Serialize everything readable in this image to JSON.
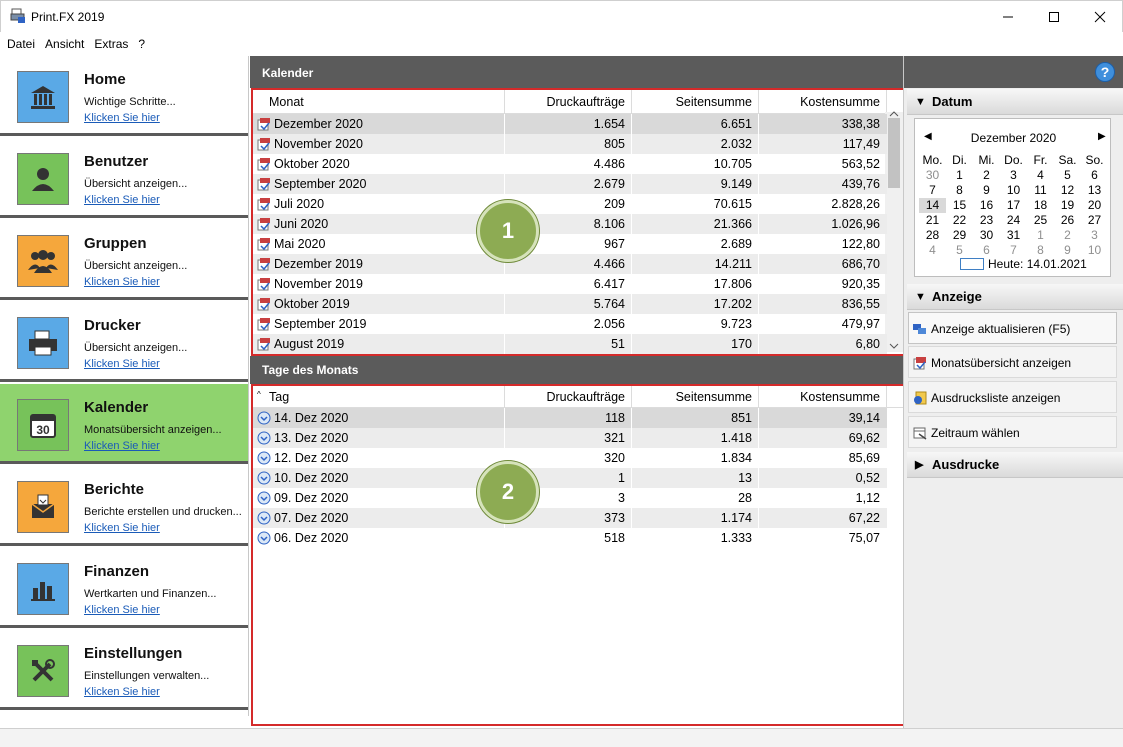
{
  "window": {
    "title": "Print.FX 2019"
  },
  "menu": [
    "Datei",
    "Ansicht",
    "Extras",
    "?"
  ],
  "nav": [
    {
      "title": "Home",
      "desc": "Wichtige Schritte...",
      "link": "Klicken Sie hier",
      "icon": "bank-icon",
      "color": "#5aa9e6"
    },
    {
      "title": "Benutzer",
      "desc": "Übersicht anzeigen...",
      "link": "Klicken Sie hier",
      "icon": "user-icon",
      "color": "#77c25a"
    },
    {
      "title": "Gruppen",
      "desc": "Übersicht anzeigen...",
      "link": "Klicken Sie hier",
      "icon": "group-icon",
      "color": "#f5a73c"
    },
    {
      "title": "Drucker",
      "desc": "Übersicht anzeigen...",
      "link": "Klicken Sie hier",
      "icon": "printer-icon",
      "color": "#5aa9e6"
    },
    {
      "title": "Kalender",
      "desc": "Monatsübersicht anzeigen...",
      "link": "Klicken Sie hier",
      "icon": "calendar-icon",
      "color": "#77c25a"
    },
    {
      "title": "Berichte",
      "desc": "Berichte erstellen und drucken...",
      "link": "Klicken Sie hier",
      "icon": "report-icon",
      "color": "#f5a73c"
    },
    {
      "title": "Finanzen",
      "desc": "Wertkarten und Finanzen...",
      "link": "Klicken Sie hier",
      "icon": "bar-chart-icon",
      "color": "#5aa9e6"
    },
    {
      "title": "Einstellungen",
      "desc": "Einstellungen verwalten...",
      "link": "Klicken Sie hier",
      "icon": "tools-icon",
      "color": "#77c25a"
    }
  ],
  "calendar_panel": {
    "title": "Kalender",
    "columns": [
      "Monat",
      "Druckaufträge",
      "Seitensumme",
      "Kostensumme"
    ],
    "rows": [
      [
        "Dezember 2020",
        "1.654",
        "6.651",
        "338,38"
      ],
      [
        "November 2020",
        "805",
        "2.032",
        "117,49"
      ],
      [
        "Oktober 2020",
        "4.486",
        "10.705",
        "563,52"
      ],
      [
        "September 2020",
        "2.679",
        "9.149",
        "439,76"
      ],
      [
        "Juli 2020",
        "209",
        "70.615",
        "2.828,26"
      ],
      [
        "Juni 2020",
        "8.106",
        "21.366",
        "1.026,96"
      ],
      [
        "Mai 2020",
        "967",
        "2.689",
        "122,80"
      ],
      [
        "Dezember 2019",
        "4.466",
        "14.211",
        "686,70"
      ],
      [
        "November 2019",
        "6.417",
        "17.806",
        "920,35"
      ],
      [
        "Oktober 2019",
        "5.764",
        "17.202",
        "836,55"
      ],
      [
        "September 2019",
        "2.056",
        "9.723",
        "479,97"
      ],
      [
        "August 2019",
        "51",
        "170",
        "6,80"
      ]
    ],
    "badge": "1"
  },
  "days_panel": {
    "title": "Tage des Monats",
    "columns": [
      "Tag",
      "Druckaufträge",
      "Seitensumme",
      "Kostensumme"
    ],
    "rows": [
      [
        "14. Dez 2020",
        "118",
        "851",
        "39,14"
      ],
      [
        "13. Dez 2020",
        "321",
        "1.418",
        "69,62"
      ],
      [
        "12. Dez 2020",
        "320",
        "1.834",
        "85,69"
      ],
      [
        "10. Dez 2020",
        "1",
        "13",
        "0,52"
      ],
      [
        "09. Dez 2020",
        "3",
        "28",
        "1,12"
      ],
      [
        "07. Dez 2020",
        "373",
        "1.174",
        "67,22"
      ],
      [
        "06. Dez 2020",
        "518",
        "1.333",
        "75,07"
      ]
    ],
    "badge": "2"
  },
  "right": {
    "help": "?",
    "datum": {
      "header": "Datum",
      "month": "Dezember 2020",
      "weekdays": [
        "Mo.",
        "Di.",
        "Mi.",
        "Do.",
        "Fr.",
        "Sa.",
        "So."
      ],
      "weeks": [
        [
          "30",
          "1",
          "2",
          "3",
          "4",
          "5",
          "6"
        ],
        [
          "7",
          "8",
          "9",
          "10",
          "11",
          "12",
          "13"
        ],
        [
          "14",
          "15",
          "16",
          "17",
          "18",
          "19",
          "20"
        ],
        [
          "21",
          "22",
          "23",
          "24",
          "25",
          "26",
          "27"
        ],
        [
          "28",
          "29",
          "30",
          "31",
          "1",
          "2",
          "3"
        ],
        [
          "4",
          "5",
          "6",
          "7",
          "8",
          "9",
          "10"
        ]
      ],
      "today": "Heute: 14.01.2021"
    },
    "anzeige": {
      "header": "Anzeige",
      "actions": [
        "Anzeige aktualisieren (F5)",
        "Monatsübersicht anzeigen",
        "Ausdrucksliste anzeigen",
        "Zeitraum wählen"
      ]
    },
    "ausdrucke": {
      "header": "Ausdrucke"
    }
  }
}
